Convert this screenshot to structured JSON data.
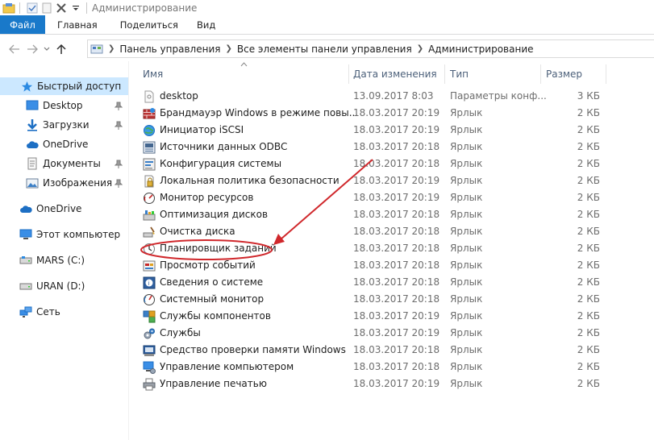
{
  "window": {
    "title": "Администрирование"
  },
  "ribbon": {
    "tabs": [
      {
        "label": "Файл"
      },
      {
        "label": "Главная"
      },
      {
        "label": "Поделиться"
      },
      {
        "label": "Вид"
      }
    ]
  },
  "address": {
    "crumbs": [
      "Панель управления",
      "Все элементы панели управления",
      "Администрирование"
    ]
  },
  "sidebar": {
    "items": [
      {
        "label": "Быстрый доступ",
        "icon": "star-icon"
      },
      {
        "label": "Desktop",
        "icon": "desktop-icon"
      },
      {
        "label": "Загрузки",
        "icon": "download-icon"
      },
      {
        "label": "OneDrive",
        "icon": "cloud-icon"
      },
      {
        "label": "Документы",
        "icon": "documents-icon"
      },
      {
        "label": "Изображения",
        "icon": "pictures-icon"
      },
      {
        "label": "OneDrive",
        "icon": "cloud-icon"
      },
      {
        "label": "Этот компьютер",
        "icon": "computer-icon"
      },
      {
        "label": "MARS (C:)",
        "icon": "drive-icon"
      },
      {
        "label": "URAN (D:)",
        "icon": "drive-icon"
      },
      {
        "label": "Сеть",
        "icon": "network-icon"
      }
    ]
  },
  "columns": {
    "name": "Имя",
    "date": "Дата изменения",
    "type": "Тип",
    "size": "Размер"
  },
  "files": [
    {
      "name": "desktop",
      "date": "13.09.2017 8:03",
      "type": "Параметры конф...",
      "size": "3 КБ"
    },
    {
      "name": "Брандмауэр Windows в режиме повы...",
      "date": "18.03.2017 20:19",
      "type": "Ярлык",
      "size": "2 КБ"
    },
    {
      "name": "Инициатор iSCSI",
      "date": "18.03.2017 20:19",
      "type": "Ярлык",
      "size": "2 КБ"
    },
    {
      "name": "Источники данных ODBC",
      "date": "18.03.2017 20:18",
      "type": "Ярлык",
      "size": "2 КБ"
    },
    {
      "name": "Конфигурация системы",
      "date": "18.03.2017 20:18",
      "type": "Ярлык",
      "size": "2 КБ"
    },
    {
      "name": "Локальная политика безопасности",
      "date": "18.03.2017 20:19",
      "type": "Ярлык",
      "size": "2 КБ"
    },
    {
      "name": "Монитор ресурсов",
      "date": "18.03.2017 20:19",
      "type": "Ярлык",
      "size": "2 КБ"
    },
    {
      "name": "Оптимизация дисков",
      "date": "18.03.2017 20:18",
      "type": "Ярлык",
      "size": "2 КБ"
    },
    {
      "name": "Очистка диска",
      "date": "18.03.2017 20:18",
      "type": "Ярлык",
      "size": "2 КБ"
    },
    {
      "name": "Планировщик заданий",
      "date": "18.03.2017 20:18",
      "type": "Ярлык",
      "size": "2 КБ"
    },
    {
      "name": "Просмотр событий",
      "date": "18.03.2017 20:18",
      "type": "Ярлык",
      "size": "2 КБ"
    },
    {
      "name": "Сведения о системе",
      "date": "18.03.2017 20:18",
      "type": "Ярлык",
      "size": "2 КБ"
    },
    {
      "name": "Системный монитор",
      "date": "18.03.2017 20:18",
      "type": "Ярлык",
      "size": "2 КБ"
    },
    {
      "name": "Службы компонентов",
      "date": "18.03.2017 20:19",
      "type": "Ярлык",
      "size": "2 КБ"
    },
    {
      "name": "Службы",
      "date": "18.03.2017 20:19",
      "type": "Ярлык",
      "size": "2 КБ"
    },
    {
      "name": "Средство проверки памяти Windows",
      "date": "18.03.2017 20:18",
      "type": "Ярлык",
      "size": "2 КБ"
    },
    {
      "name": "Управление компьютером",
      "date": "18.03.2017 20:18",
      "type": "Ярлык",
      "size": "2 КБ"
    },
    {
      "name": "Управление печатью",
      "date": "18.03.2017 20:19",
      "type": "Ярлык",
      "size": "2 КБ"
    }
  ],
  "colors": {
    "accent": "#1979ca",
    "selection": "#cce8ff",
    "annotation": "#d0282c",
    "header_text": "#4c607a"
  }
}
